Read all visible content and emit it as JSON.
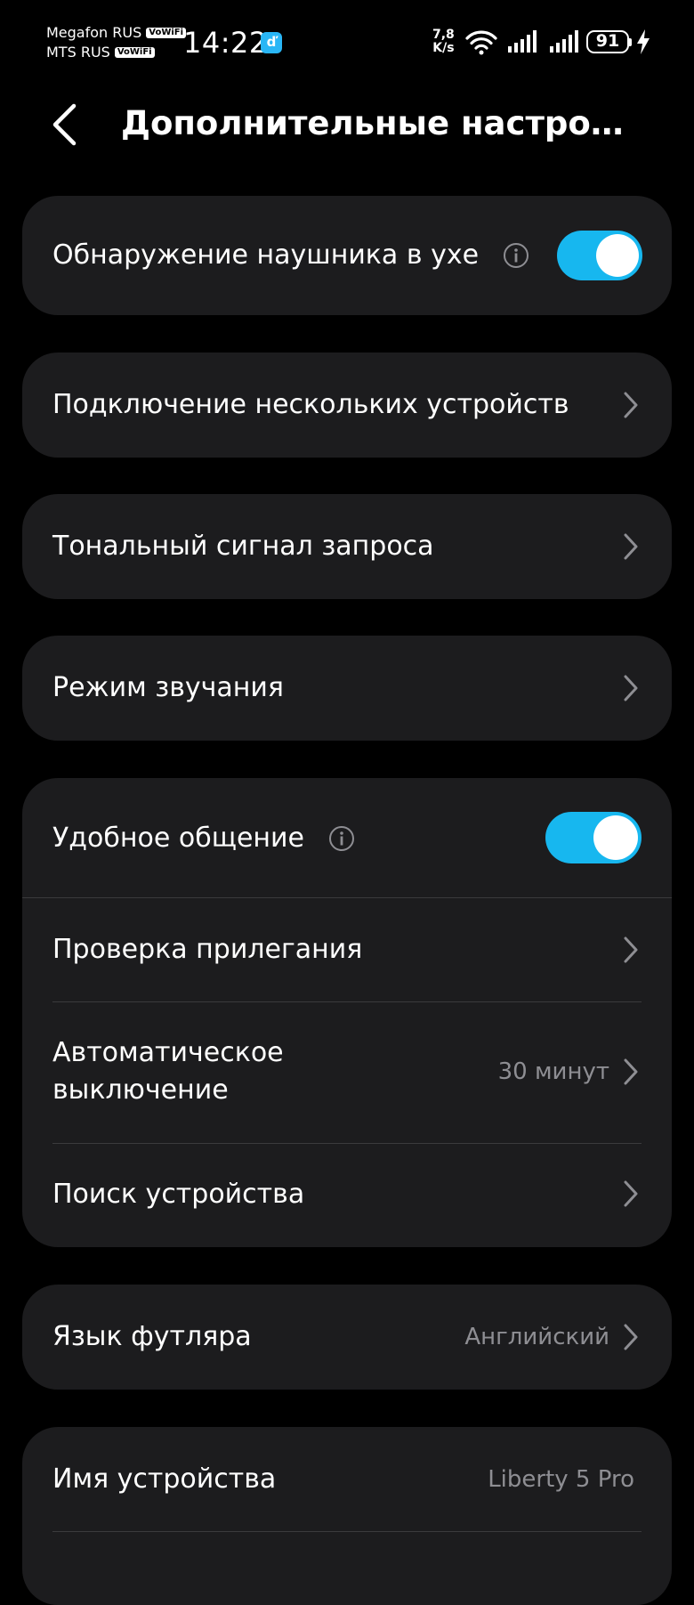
{
  "status_bar": {
    "carrier_1": "Megafon RUS",
    "carrier_2": "MTS RUS",
    "vowifi_label": "VoWiFi",
    "time": "14:22",
    "app_notification_glyph": "ď",
    "network_speed_value": "7,8",
    "network_speed_unit": "K/s",
    "battery_level": "91",
    "icons": [
      "wifi-icon",
      "signal-icon",
      "signal-icon",
      "battery-icon",
      "charging-bolt-icon"
    ]
  },
  "header": {
    "title": "Дополнительные настро…",
    "back_icon": "chevron-left-icon"
  },
  "settings": {
    "in_ear_detection": {
      "label": "Обнаружение наушника в ухе",
      "enabled": true
    },
    "multipoint": {
      "label": "Подключение нескольких устройств"
    },
    "prompt_tone": {
      "label": "Тональный сигнал запроса"
    },
    "sound_mode": {
      "label": "Режим звучания"
    },
    "easy_chat": {
      "label": "Удобное общение",
      "enabled": true
    },
    "fit_test": {
      "label": "Проверка прилегания"
    },
    "auto_off": {
      "label_line_1": "Автоматическое",
      "label_line_2": "выключение",
      "value": "30 минут"
    },
    "find_device": {
      "label": "Поиск устройства"
    },
    "case_language": {
      "label": "Язык футляра",
      "value": "Английский"
    },
    "device_name": {
      "label": "Имя устройства",
      "value": "Liberty 5 Pro"
    }
  },
  "colors": {
    "background": "#000000",
    "card": "#1c1c1e",
    "accent_toggle": "#17b7ef",
    "secondary_text": "#8e8e93",
    "divider": "#3a3a3c"
  }
}
